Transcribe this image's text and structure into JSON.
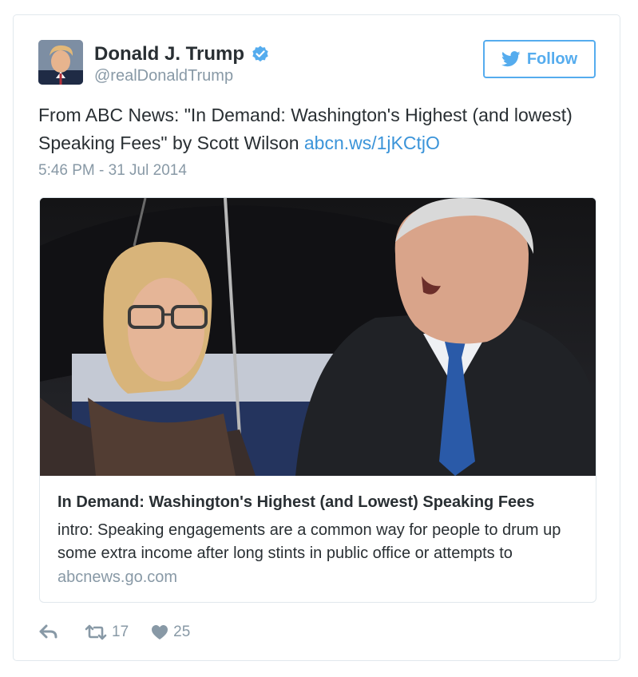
{
  "tweet": {
    "author_name": "Donald J. Trump",
    "author_handle": "@realDonaldTrump",
    "follow_label": "Follow",
    "text_plain": "From ABC News: \"In Demand: Washington's Highest (and lowest) Speaking Fees\" by Scott Wilson ",
    "link_text": "abcn.ws/1jKCtjO",
    "timestamp": "5:46 PM - 31 Jul 2014",
    "retweet_count": "17",
    "like_count": "25"
  },
  "link_card": {
    "title": "In Demand: Washington's Highest (and Lowest) Speaking Fees",
    "description": "intro: Speaking engagements are a common way for people to drum up some extra income after long stints in public office or attempts to",
    "domain": "abcnews.go.com"
  },
  "icons": {
    "verified": "verified-badge-icon",
    "bird": "twitter-bird-icon",
    "reply": "reply-icon",
    "retweet": "retweet-icon",
    "like": "heart-icon"
  },
  "colors": {
    "accent": "#55acee",
    "link": "#3b94d9",
    "muted": "#8899a6",
    "text": "#292f33",
    "border": "#e1e8ed"
  }
}
